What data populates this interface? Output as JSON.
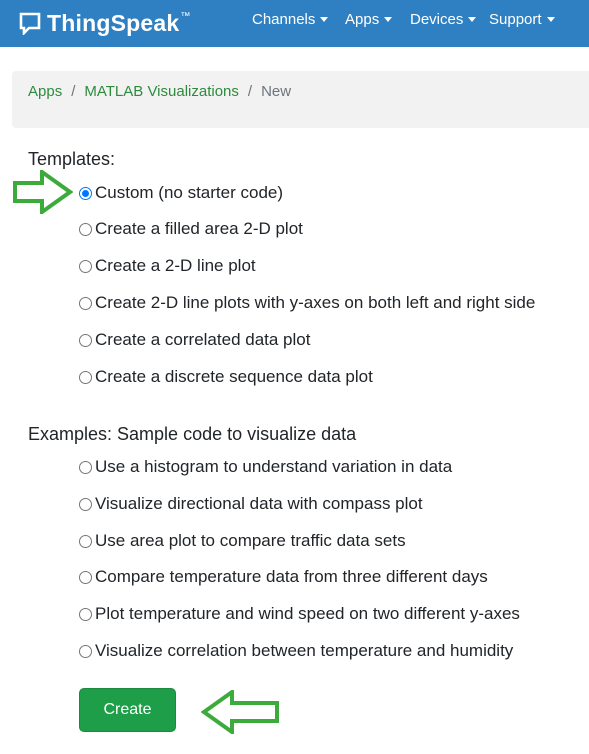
{
  "navbar": {
    "brand": "ThingSpeak",
    "brand_tm": "™",
    "menus": [
      "Channels",
      "Apps",
      "Devices",
      "Support"
    ]
  },
  "breadcrumb": {
    "items": [
      "Apps",
      "MATLAB Visualizations"
    ],
    "separator": "/",
    "current": "New"
  },
  "templates": {
    "heading": "Templates:",
    "options": [
      {
        "label": "Custom (no starter code)",
        "selected": true
      },
      {
        "label": "Create a filled area 2-D plot",
        "selected": false
      },
      {
        "label": "Create a 2-D line plot",
        "selected": false
      },
      {
        "label": "Create 2-D line plots with y-axes on both left and right side",
        "selected": false
      },
      {
        "label": "Create a correlated data plot",
        "selected": false
      },
      {
        "label": "Create a discrete sequence data plot",
        "selected": false
      }
    ]
  },
  "examples": {
    "heading": "Examples: Sample code to visualize data",
    "options": [
      {
        "label": "Use a histogram to understand variation in data",
        "selected": false
      },
      {
        "label": "Visualize directional data with compass plot",
        "selected": false
      },
      {
        "label": "Use area plot to compare traffic data sets",
        "selected": false
      },
      {
        "label": "Compare temperature data from three different days",
        "selected": false
      },
      {
        "label": "Plot temperature and wind speed on two different y-axes",
        "selected": false
      },
      {
        "label": "Visualize correlation between temperature and humidity",
        "selected": false
      }
    ]
  },
  "create_button": {
    "label": "Create"
  },
  "colors": {
    "navbar": "#2e80c2",
    "link_green": "#2e8b3c",
    "button_green": "#1e9e48",
    "annotation_arrow": "#3cab3c",
    "radio_checked": "#0075ff"
  }
}
